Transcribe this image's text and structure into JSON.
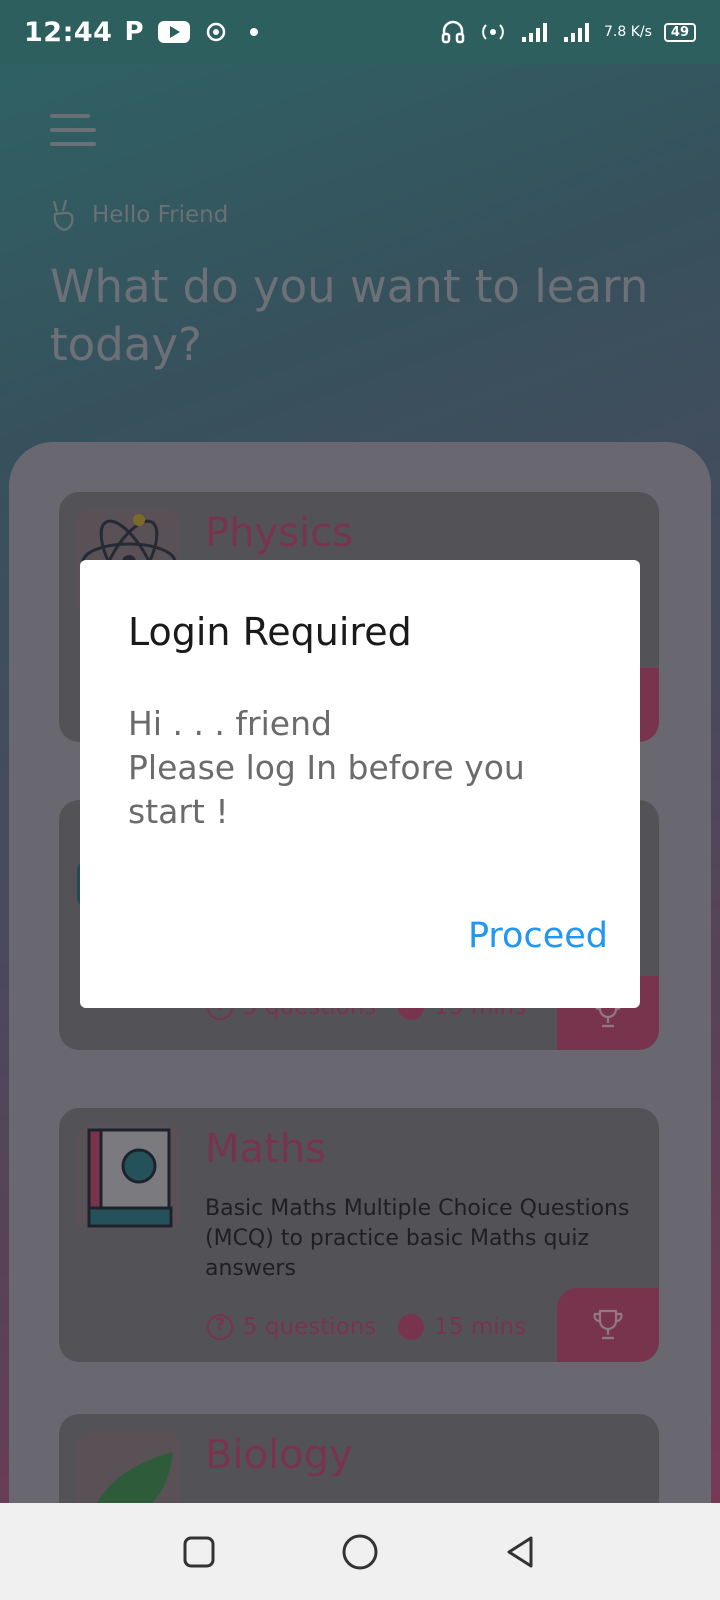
{
  "status_bar": {
    "time": "12:44",
    "left_icons": [
      "p-icon",
      "youtube-icon",
      "settings-sync-icon"
    ],
    "network_speed": "7.8 K/s",
    "battery": "49",
    "right_icons": [
      "headphones-icon",
      "hotspot-icon",
      "signal-icon",
      "signal-e-icon"
    ]
  },
  "header": {
    "menu_icon": "hamburger-menu-icon",
    "greeting": "Hello Friend",
    "headline": "What do you want to learn today?"
  },
  "courses": [
    {
      "title": "Physics",
      "icon": "atom-icon",
      "description": "",
      "questions": "",
      "duration": ""
    },
    {
      "title": "",
      "icon": "globe-icon",
      "description": "",
      "questions": "5 questions",
      "duration": "15 mins"
    },
    {
      "title": "Maths",
      "icon": "book-icon",
      "description": "Basic Maths Multiple Choice Questions (MCQ) to practice basic Maths quiz answers",
      "questions": "5 questions",
      "duration": "15 mins"
    },
    {
      "title": "Biology",
      "icon": "leaf-icon",
      "description": "",
      "questions": "",
      "duration": ""
    }
  ],
  "dialog": {
    "title": "Login Required",
    "message": "Hi . . . friend\nPlease log In before you start !",
    "action": "Proceed"
  },
  "colors": {
    "accent": "#c2456a",
    "dialog_button": "#2196f3",
    "status_bar": "#2c5f5d"
  }
}
